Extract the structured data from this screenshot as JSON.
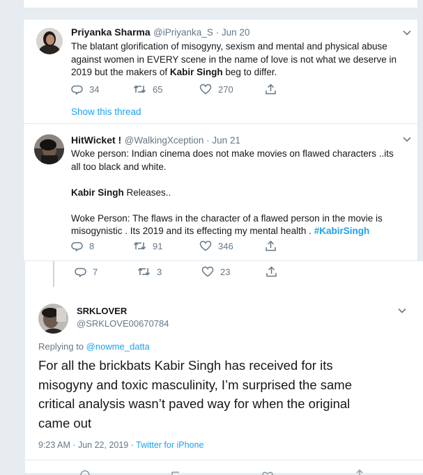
{
  "tweet1": {
    "name": "Priyanka Sharma",
    "handle_date": "@iPriyanka_S · Jun 20",
    "line1": "The blatant glorification of misogyny, sexism and mental and physical abuse",
    "line2": "against women in EVERY scene in the name of love is not what we deserve in",
    "line3_pre": "2019 but the makers of ",
    "line3_bold": "Kabir Singh",
    "line3_post": " beg to differ.",
    "replies": "34",
    "retweets": "65",
    "likes": "270",
    "show_thread": "Show this thread"
  },
  "tweet2": {
    "name": "HitWicket !",
    "handle_date": "@WalkingXception · Jun 21",
    "line1": "Woke person: Indian cinema does not make movies on flawed characters ..its",
    "line2": "all too black and white.",
    "line3_bold": "Kabir Singh",
    "line3_post": " Releases..",
    "line4": "Woke Person: The flaws in the character of a flawed person in the movie is",
    "line5_pre": "misogynistic . Its 2019 and its effecting my mental health . ",
    "line5_tag": "#KabirSingh",
    "replies": "8",
    "retweets": "91",
    "likes": "346"
  },
  "parent_actions": {
    "replies": "7",
    "retweets": "3",
    "likes": "23"
  },
  "tweet3": {
    "name": "SRKLOVER",
    "handle": "@SRKLOVE00670784",
    "replying_prefix": "Replying to ",
    "replying_handle": "@nowme_datta",
    "line1": "For all the brickbats Kabir Singh has received for its",
    "line2": "misogyny and toxic masculinity, I’m surprised the same",
    "line3": "critical analysis wasn’t paved way for when the original",
    "line4": "came out",
    "timestamp": "9:23 AM · Jun 22, 2019 · ",
    "source": "Twitter for iPhone"
  },
  "colors": {
    "accent": "#1da1f2",
    "muted": "#657786",
    "background": "#e6ecf0"
  }
}
